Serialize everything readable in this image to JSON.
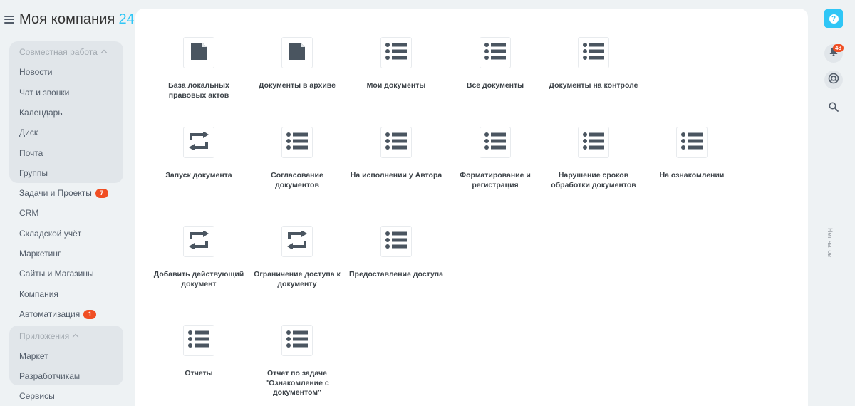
{
  "brand": {
    "name": "Моя компания",
    "suffix": "24"
  },
  "sidebar": {
    "collab_group": {
      "title": "Совместная работа",
      "items": [
        "Новости",
        "Чат и звонки",
        "Календарь",
        "Диск",
        "Почта",
        "Группы"
      ]
    },
    "items": [
      {
        "label": "Задачи и Проекты",
        "badge": "7"
      },
      {
        "label": "CRM"
      },
      {
        "label": "Складской учёт"
      },
      {
        "label": "Маркетинг"
      },
      {
        "label": "Сайты и Магазины"
      },
      {
        "label": "Компания"
      },
      {
        "label": "Автоматизация",
        "badge": "1"
      }
    ],
    "apps_group": {
      "title": "Приложения",
      "items": [
        "Маркет",
        "Разработчикам"
      ]
    },
    "bottom": [
      "Сервисы"
    ]
  },
  "tiles": [
    {
      "label": "База локальных правовых актов",
      "icon": "document-icon"
    },
    {
      "label": "Документы в архиве",
      "icon": "document-icon"
    },
    {
      "label": "Мои документы",
      "icon": "list-icon"
    },
    {
      "label": "Все документы",
      "icon": "list-icon"
    },
    {
      "label": "Документы на контроле",
      "icon": "list-icon"
    },
    {
      "label": "Запуск документа",
      "icon": "process-icon"
    },
    {
      "label": "Согласование документов",
      "icon": "list-icon"
    },
    {
      "label": "На исполнении у Автора",
      "icon": "list-icon"
    },
    {
      "label": "Форматирование и регистрация",
      "icon": "list-icon"
    },
    {
      "label": "Нарушение сроков обработки документов",
      "icon": "list-icon"
    },
    {
      "label": "На ознакомлении",
      "icon": "list-icon"
    },
    {
      "label": "Добавить действующий документ",
      "icon": "process-icon"
    },
    {
      "label": "Ограничение доступа к документу",
      "icon": "process-icon"
    },
    {
      "label": "Предоставление доступа",
      "icon": "list-icon"
    },
    {
      "label": "Отчеты",
      "icon": "list-icon"
    },
    {
      "label": "Отчет по задаче \"Ознакомление с документом\"",
      "icon": "list-icon"
    }
  ],
  "rail": {
    "help_label": "?",
    "notifications_badge": "48",
    "no_chats": "Нет чатов"
  },
  "colors": {
    "accent": "#2fc6f6",
    "badge": "#f04e23",
    "icon": "#4a5560",
    "sidebar_text": "#525c69"
  }
}
